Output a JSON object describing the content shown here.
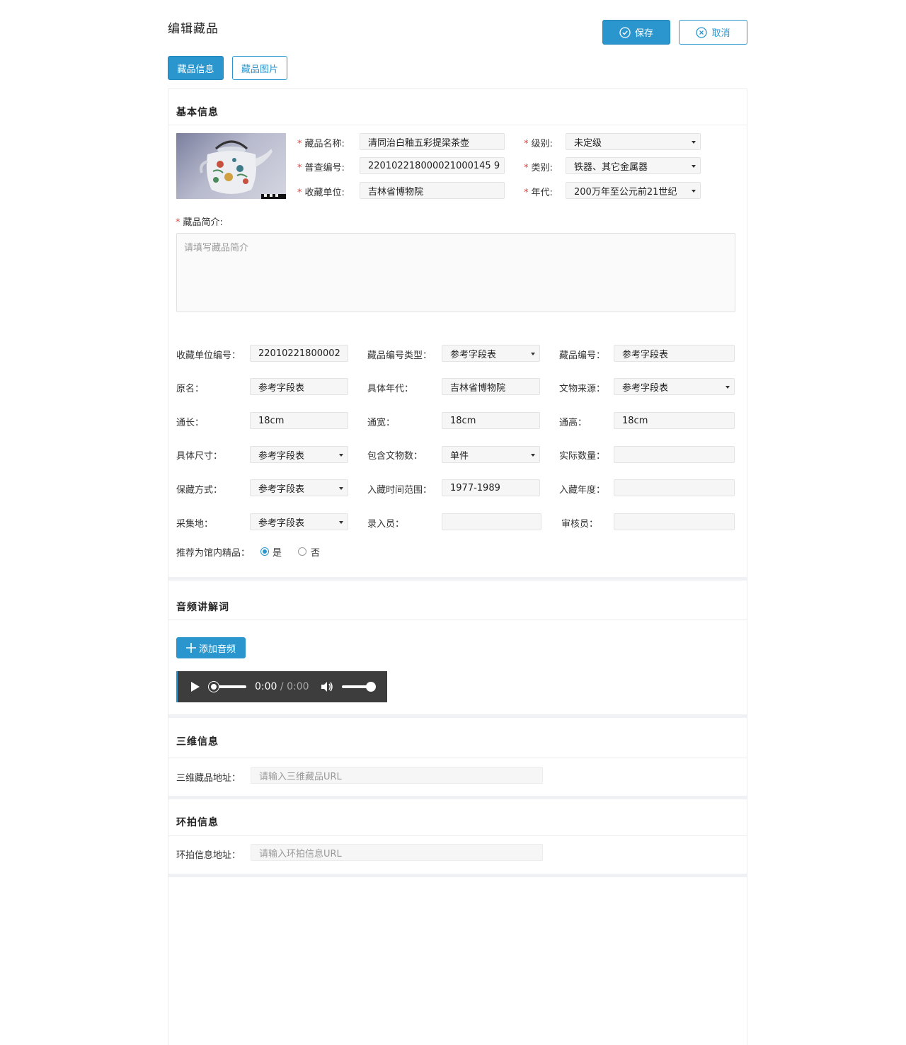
{
  "page": {
    "title": "编辑藏品",
    "save_label": "保存",
    "cancel_label": "取消"
  },
  "tabs": [
    {
      "label": "藏品信息",
      "active": true
    },
    {
      "label": "藏品图片",
      "active": false
    }
  ],
  "basic": {
    "title": "基本信息",
    "name_label": "藏品名称:",
    "name_value": "清同治白釉五彩提梁茶壶",
    "level_label": "级别:",
    "level_value": "未定级",
    "survey_label": "普查编号:",
    "survey_value": "220102218000021000145 9",
    "category_label": "类别:",
    "category_value": "铁器、其它金属器",
    "unit_label": "收藏单位:",
    "unit_value": "吉林省博物院",
    "era_label": "年代:",
    "era_value": "200万年至公元前21世纪",
    "intro_label": "藏品简介:",
    "intro_placeholder": "请填写藏品简介"
  },
  "details": {
    "unit_code_label": "收藏单位编号：",
    "unit_code_value": "22010221800002",
    "code_type_label": "藏品编号类型：",
    "code_type_value": "参考字段表",
    "code_label": "藏品编号：",
    "code_value": "参考字段表",
    "orig_name_label": "原名：",
    "orig_name_value": "参考字段表",
    "era_label": "具体年代：",
    "era_value": "吉林省博物院",
    "source_label": "文物来源：",
    "source_value": "参考字段表",
    "length_label": "通长：",
    "length_value": "18cm",
    "width_label": "通宽：",
    "width_value": "18cm",
    "height_label": "通高：",
    "height_value": "18cm",
    "size_label": "具体尺寸：",
    "size_value": "参考字段表",
    "count_label": "包含文物数：",
    "count_value": "单件",
    "actual_label": "实际数量：",
    "actual_value": "",
    "storage_label": "保藏方式：",
    "storage_value": "参考字段表",
    "period_label": "入藏时间范围：",
    "period_value": "1977-1989",
    "year_label": "入藏年度：",
    "year_value": "",
    "place_label": "采集地：",
    "place_value": "参考字段表",
    "recorder_label": "录入员：",
    "recorder_value": "",
    "reviewer_label": "审核员：",
    "reviewer_value": "",
    "recommend_label": "推荐为馆内精品：",
    "yes_label": "是",
    "no_label": "否",
    "recommend_selected": "是"
  },
  "audio": {
    "title": "音频讲解词",
    "add_label": "添加音频",
    "current_time": "0:00",
    "duration": "/ 0:00",
    "volume": 0.9,
    "progress": 0
  },
  "three_d": {
    "title": "三维信息",
    "url_label": "三维藏品地址：",
    "url_placeholder": "请输入三维藏品URL"
  },
  "panorama": {
    "title": "环拍信息",
    "url_label": "环拍信息地址：",
    "url_placeholder": "请输入环拍信息URL"
  },
  "colors": {
    "primary": "#2a96cd",
    "required": "#e8403a"
  }
}
